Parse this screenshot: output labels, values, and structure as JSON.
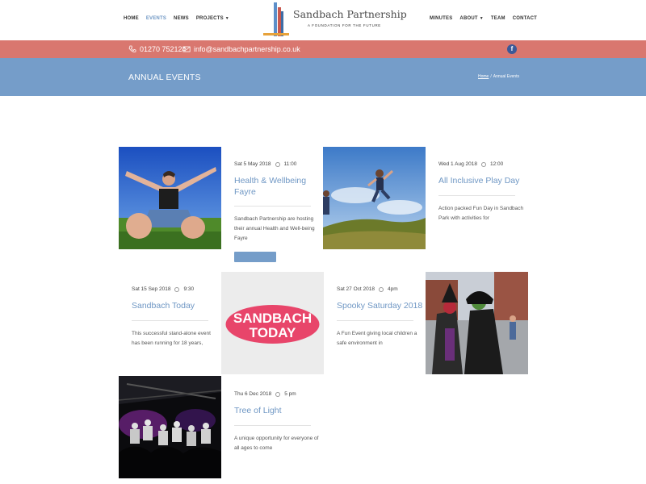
{
  "nav_left": [
    {
      "label": "HOME"
    },
    {
      "label": "EVENTS"
    },
    {
      "label": "NEWS"
    },
    {
      "label": "PROJECTS"
    }
  ],
  "nav_right": [
    {
      "label": "MINUTES"
    },
    {
      "label": "ABOUT"
    },
    {
      "label": "TEAM"
    },
    {
      "label": "CONTACT"
    }
  ],
  "logo": {
    "title": "Sandbach Partnership",
    "tagline": "A FOUNDATION FOR THE FUTURE"
  },
  "contact": {
    "phone": "01270 752124",
    "email": "info@sandbachpartnership.co.uk",
    "social": "f"
  },
  "page": {
    "title": "ANNUAL EVENTS",
    "breadcrumb": [
      "Home",
      "/",
      "Annual Events"
    ]
  },
  "colors": {
    "accent": "#759dc9",
    "contact_bar": "#d9776f",
    "title_link": "#6f97c4"
  },
  "events": [
    {
      "date": "Sat 5 May 2018",
      "time": "11:00",
      "title": "Health & Wellbeing Fayre",
      "desc": "Sandbach Partnership are hosting their annual Health and Well-being Fayre"
    },
    {
      "date": "Wed 1 Aug 2018",
      "time": "12:00",
      "title": "All Inclusive Play Day",
      "desc": "Action packed Fun Day in Sandbach Park with activities for"
    },
    {
      "date": "Sat 15 Sep 2018",
      "time": "9:30",
      "title": "Sandbach Today",
      "desc": "This successful stand-alone event has been running for 18 years,",
      "logo_line1": "SANDBACH",
      "logo_line2": "TODAY"
    },
    {
      "date": "Sat 27 Oct 2018",
      "time": "4pm",
      "title": "Spooky Saturday 2018",
      "desc": "A Fun Event giving local children a safe environment in"
    },
    {
      "date": "Thu 6 Dec 2018",
      "time": "5 pm",
      "title": "Tree of Light",
      "desc": "A unique opportunity for everyone of all ages to come"
    }
  ]
}
